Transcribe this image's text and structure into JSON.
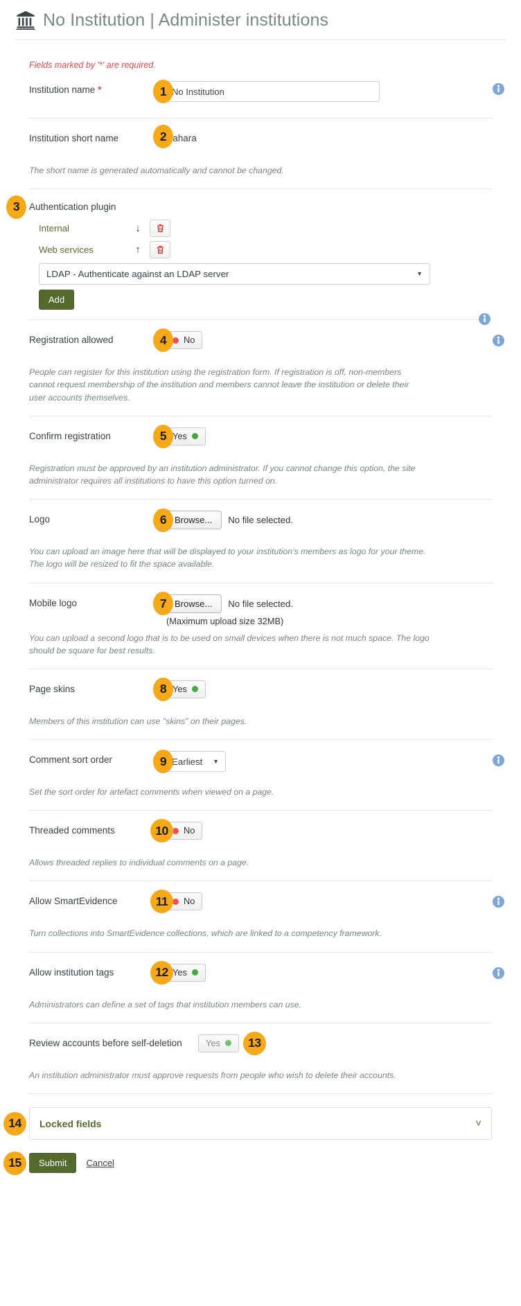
{
  "header": {
    "icon": "bank-institution-icon",
    "institution": "No Institution",
    "separator": "|",
    "section": "Administer institutions",
    "title": "No Institution | Administer institutions"
  },
  "form": {
    "required_note": "Fields marked by '*' are required.",
    "institution_name": {
      "label": "Institution name",
      "required_marker": "*",
      "value": "No Institution",
      "info_icon": "info-circle-icon"
    },
    "institution_short_name": {
      "label": "Institution short name",
      "value": "mahara",
      "help": "The short name is generated automatically and cannot be changed."
    },
    "authentication_plugin": {
      "label": "Authentication plugin",
      "plugins": [
        {
          "name": "Internal",
          "arrow": "↓",
          "arrow_name": "move-down-arrow",
          "delete_icon": "trash-icon"
        },
        {
          "name": "Web services",
          "arrow": "↑",
          "arrow_name": "move-up-arrow",
          "delete_icon": "trash-icon"
        }
      ],
      "select_value": "LDAP - Authenticate against an LDAP server",
      "add_label": "Add",
      "info_icon": "info-circle-icon"
    },
    "registration_allowed": {
      "label": "Registration allowed",
      "value": "No",
      "state": "off",
      "help": "People can register for this institution using the registration form. If registration is off, non-members cannot request membership of the institution and members cannot leave the institution or delete their user accounts themselves.",
      "info_icon": "info-circle-icon"
    },
    "confirm_registration": {
      "label": "Confirm registration",
      "value": "Yes",
      "state": "on",
      "help": "Registration must be approved by an institution administrator. If you cannot change this option, the site administrator requires all institutions to have this option turned on."
    },
    "logo": {
      "label": "Logo",
      "browse_label": "Browse...",
      "file_status": "No file selected.",
      "help": "You can upload an image here that will be displayed to your institution's members as logo for your theme. The logo will be resized to fit the space available."
    },
    "mobile_logo": {
      "label": "Mobile logo",
      "browse_label": "Browse...",
      "file_status": "No file selected.",
      "max_upload": "(Maximum upload size 32MB)",
      "help": "You can upload a second logo that is to be used on small devices when there is not much space. The logo should be square for best results."
    },
    "page_skins": {
      "label": "Page skins",
      "value": "Yes",
      "state": "on",
      "help": "Members of this institution can use \"skins\" on their pages."
    },
    "comment_sort_order": {
      "label": "Comment sort order",
      "value": "Earliest",
      "help": "Set the sort order for artefact comments when viewed on a page.",
      "info_icon": "info-circle-icon"
    },
    "threaded_comments": {
      "label": "Threaded comments",
      "value": "No",
      "state": "off",
      "help": "Allows threaded replies to individual comments on a page."
    },
    "allow_smartevidence": {
      "label": "Allow SmartEvidence",
      "value": "No",
      "state": "off",
      "help": "Turn collections into SmartEvidence collections, which are linked to a competency framework.",
      "info_icon": "info-circle-icon"
    },
    "allow_institution_tags": {
      "label": "Allow institution tags",
      "value": "Yes",
      "state": "on",
      "help": "Administrators can define a set of tags that institution members can use.",
      "info_icon": "info-circle-icon"
    },
    "review_accounts": {
      "label": "Review accounts before self-deletion",
      "value": "Yes",
      "state": "on",
      "disabled": true,
      "help": "An institution administrator must approve requests from people who wish to delete their accounts."
    },
    "locked_fields": {
      "label": "Locked fields",
      "caret_icon": "chevron-down-icon"
    },
    "submit_label": "Submit",
    "cancel_label": "Cancel"
  },
  "callouts": [
    {
      "n": "1"
    },
    {
      "n": "2"
    },
    {
      "n": "3"
    },
    {
      "n": "4"
    },
    {
      "n": "5"
    },
    {
      "n": "6"
    },
    {
      "n": "7"
    },
    {
      "n": "8"
    },
    {
      "n": "9"
    },
    {
      "n": "10"
    },
    {
      "n": "11"
    },
    {
      "n": "12"
    },
    {
      "n": "13"
    },
    {
      "n": "14"
    },
    {
      "n": "15"
    }
  ],
  "colors": {
    "badge": "#f5a818",
    "required": "#e2474a",
    "green_button": "#556b2d",
    "link_green": "#556b2d",
    "info_blue": "#7da7d9",
    "status_on": "#3faa41",
    "status_off": "#f0504f",
    "trash_red": "#ee2222"
  }
}
